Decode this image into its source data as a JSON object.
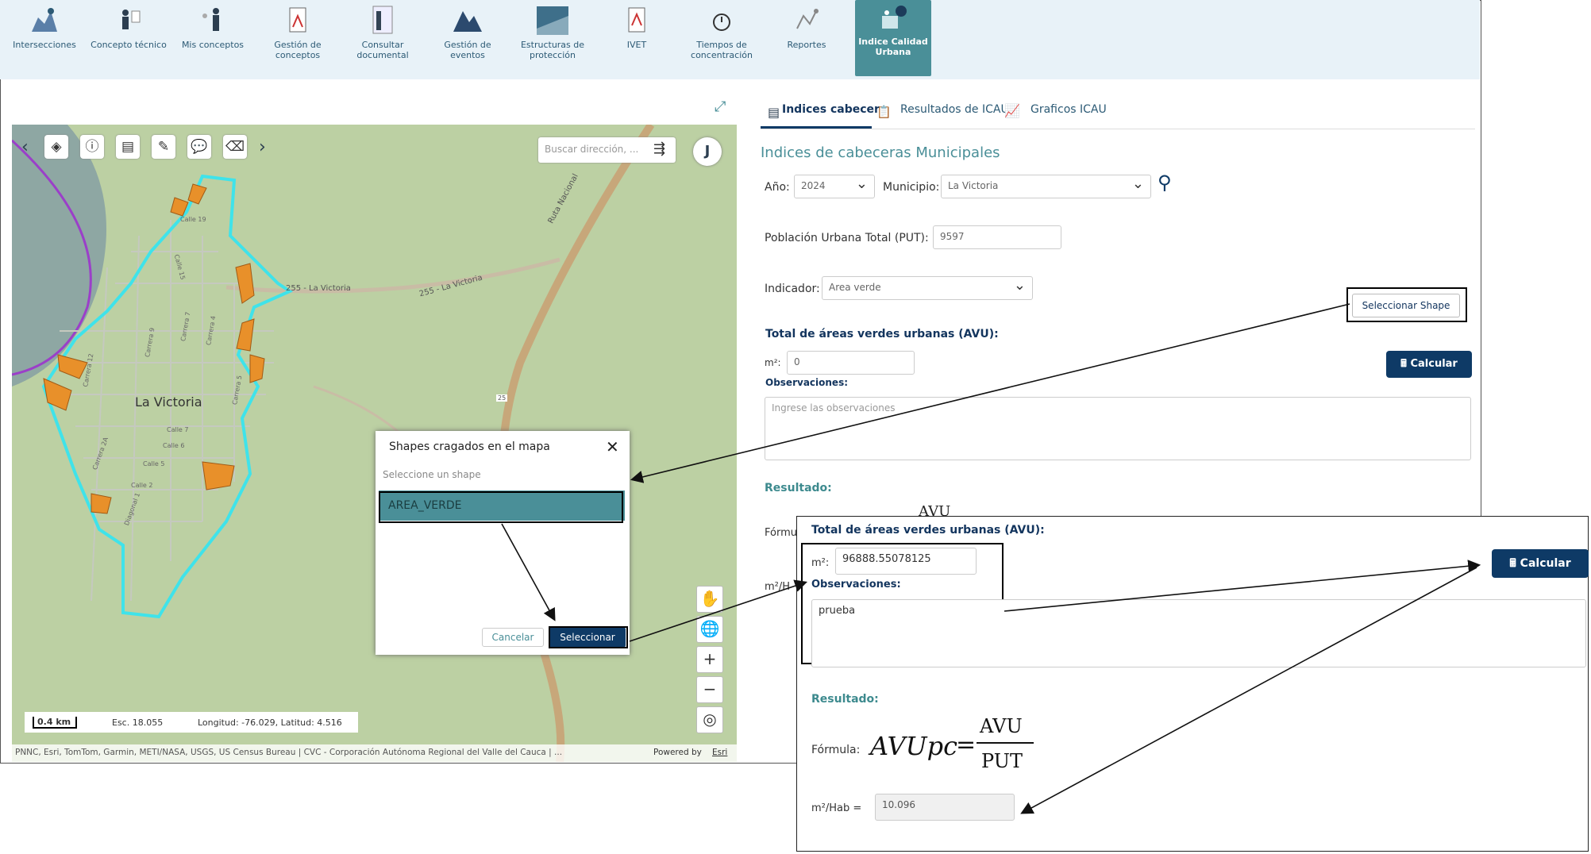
{
  "nav": {
    "items": [
      {
        "label": "Intersecciones"
      },
      {
        "label": "Concepto técnico"
      },
      {
        "label": "Mis conceptos"
      },
      {
        "label": "Gestión de\nconceptos"
      },
      {
        "label": "Consultar\ndocumental"
      },
      {
        "label": "Gestión de eventos"
      },
      {
        "label": "Estructuras de\nprotección"
      },
      {
        "label": "IVET"
      },
      {
        "label": "Tiempos de\nconcentración"
      },
      {
        "label": "Reportes"
      },
      {
        "label": "Indice Calidad\nUrbana"
      }
    ]
  },
  "map": {
    "search_placeholder": "Buscar dirección, ...",
    "user_initial": "J",
    "place_label": "La Victoria",
    "road_labels": [
      "Ruta Nacional",
      "255 - La Victoria",
      "255 - La Victoria",
      "25"
    ],
    "street_labels": [
      "Calle 19",
      "Calle 15",
      "Carrera 9",
      "Carrera 7",
      "Carrera 5",
      "Calle 7",
      "Calle 6",
      "Calle 5",
      "Carrera 4",
      "Calle 2",
      "Carrera 2A",
      "Carrera 12",
      "Diagonal 1"
    ],
    "scale_label": "0.4 km",
    "scale_value": "Esc. 18.055",
    "coordinates": "Longitud: -76.029, Latitud: 4.516",
    "attribution": "PNNC, Esri, TomTom, Garmin, METI/NASA, USGS, US Census Bureau | CVC - Corporación Autónoma Regional del Valle del Cauca | ...",
    "powered_by": "Powered by",
    "powered_by_link": "Esri"
  },
  "dialog": {
    "title": "Shapes cragados en el mapa",
    "hint": "Seleccione un shape",
    "option": "AREA_VERDE",
    "cancel_label": "Cancelar",
    "select_label": "Seleccionar"
  },
  "tabs": [
    {
      "label": "Indices cabecera"
    },
    {
      "label": "Resultados de ICAU"
    },
    {
      "label": "Graficos ICAU"
    }
  ],
  "panel": {
    "title": "Indices de cabeceras Municipales",
    "year_label": "Año:",
    "year_value": "2024",
    "municipio_label": "Municipio:",
    "municipio_value": "La Victoria",
    "put_label": "Población Urbana Total (PUT):",
    "put_value": "9597",
    "indicator_label": "Indicador:",
    "indicator_value": "Area verde",
    "select_shape_label": "Seleccionar Shape",
    "avu_title": "Total de áreas verdes urbanas (AVU):",
    "m2_label": "m²:",
    "m2_value": "0",
    "calc_label": "Calcular",
    "obs_label": "Observaciones:",
    "obs_placeholder": "Ingrese las observaciones",
    "result_label": "Resultado:",
    "formula_label_partial": "Fórmu",
    "m2hab_partial": "m²/H",
    "avu_partial": "AVU"
  },
  "zoom": {
    "avu_title": "Total de áreas verdes urbanas (AVU):",
    "m2_label": "m²:",
    "m2_value": "96888.55078125",
    "obs_label": "Observaciones:",
    "obs_value": "prueba",
    "result_label": "Resultado:",
    "formula_label": "Fórmula:",
    "formula_lhs": "AVUpc",
    "formula_eq": "=",
    "formula_num": "AVU",
    "formula_den": "PUT",
    "m2hab_label": "m²/Hab =",
    "m2hab_value": "10.096",
    "calc_label": "Calcular"
  },
  "colors": {
    "accent_dark": "#0e3a66",
    "teal": "#4a8f98",
    "shape_outline": "#3fe3ea",
    "green_area": "#e8902a"
  }
}
